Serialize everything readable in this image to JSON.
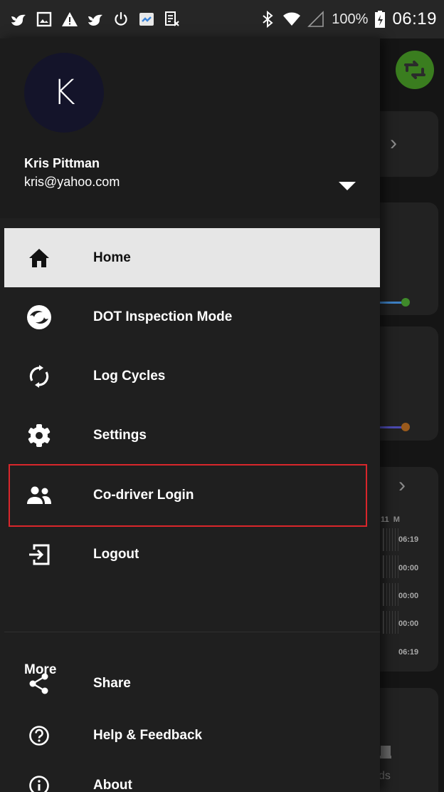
{
  "status_bar": {
    "battery": "100%",
    "time": "06:19"
  },
  "background": {
    "log_grid": {
      "header_label": "11",
      "header_mark": "M",
      "times": [
        "06:19",
        "00:00",
        "00:00",
        "00:00",
        "06:19"
      ]
    },
    "partial_text": "ds"
  },
  "drawer": {
    "avatar_letter": "K",
    "user_name": "Kris Pittman",
    "user_email": "kris@yahoo.com",
    "menu": [
      {
        "label": "Home",
        "icon": "home-icon",
        "active": true
      },
      {
        "label": "DOT Inspection Mode",
        "icon": "dot-logo-icon",
        "active": false
      },
      {
        "label": "Log Cycles",
        "icon": "sync-icon",
        "active": false
      },
      {
        "label": "Settings",
        "icon": "gear-icon",
        "active": false
      },
      {
        "label": "Co-driver Login",
        "icon": "people-icon",
        "active": false,
        "highlighted": true
      },
      {
        "label": "Logout",
        "icon": "exit-icon",
        "active": false
      }
    ],
    "more_section_title": "More",
    "more_menu": [
      {
        "label": "Share",
        "icon": "share-icon"
      },
      {
        "label": "Help & Feedback",
        "icon": "help-circle-icon"
      },
      {
        "label": "About",
        "icon": "info-circle-icon"
      }
    ]
  },
  "colors": {
    "drawer_bg": "#1f1f1f",
    "active_item_bg": "#e6e6e6",
    "highlight_border": "#d9262b",
    "fab_green": "#3a7d1f",
    "avatar_bg": "#14142a"
  }
}
